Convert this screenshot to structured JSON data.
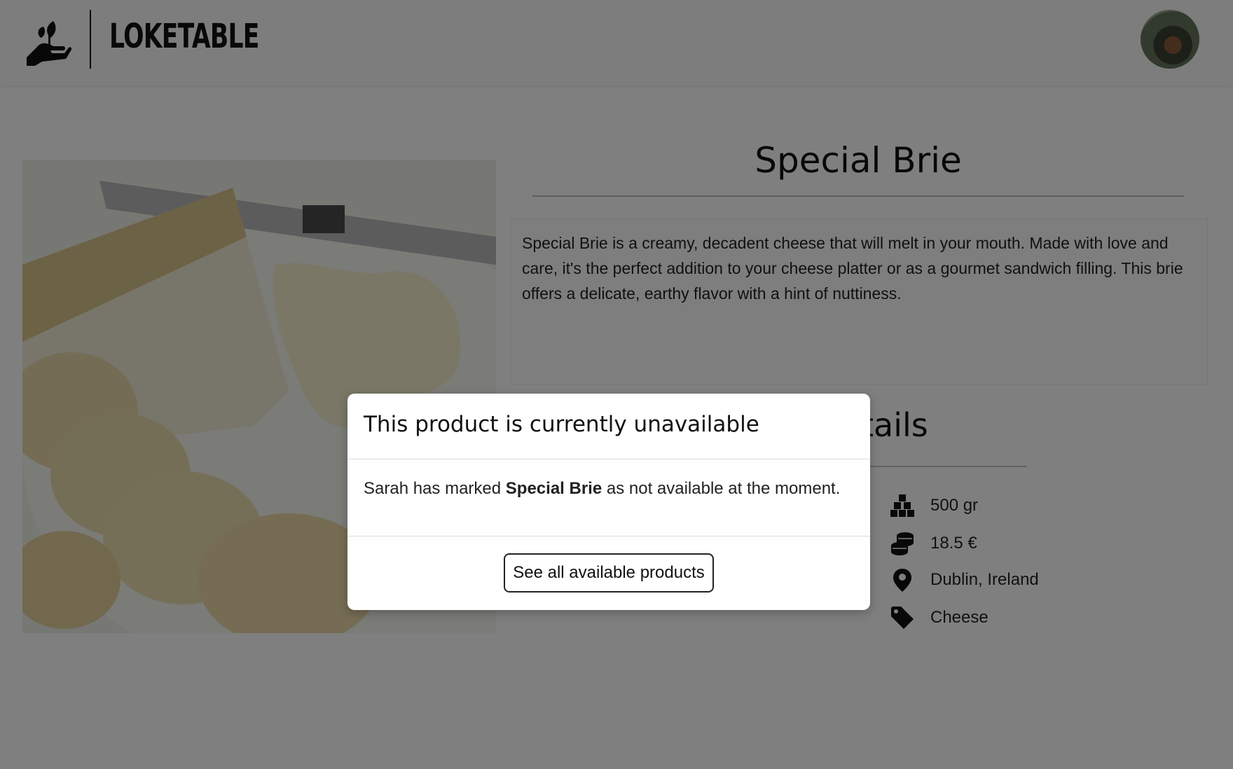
{
  "header": {
    "brand": "LOKETABLE"
  },
  "product": {
    "title": "Special Brie",
    "description": "Special Brie is a creamy, decadent cheese that will melt in your mouth. Made with love and care, it's the perfect addition to your cheese platter or as a gourmet sandwich filling. This brie offers a delicate, earthy flavor with a hint of nuttiness.",
    "details_title": "Details",
    "details": [
      {
        "icon": "cubes-icon",
        "text": "500 gr"
      },
      {
        "icon": "coins-icon",
        "text": "18.5 €"
      },
      {
        "icon": "location-pin-icon",
        "text": "Dublin, Ireland"
      },
      {
        "icon": "tag-icon",
        "text": "Cheese"
      }
    ]
  },
  "modal": {
    "title": "This product is currently unavailable",
    "body_prefix": "Sarah has marked",
    "body_product": "Special Brie",
    "body_suffix": "as not available at the moment.",
    "button_label": "See all available products"
  },
  "colors": {
    "overlay": "#000000",
    "text": "#222222",
    "modal_bg": "#ffffff"
  }
}
